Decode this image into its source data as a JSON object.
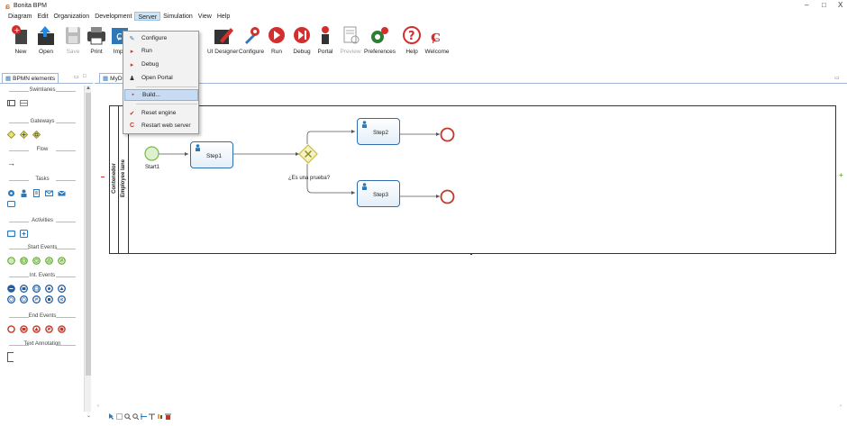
{
  "window": {
    "title": "Bonita BPM",
    "minimize": "–",
    "maximize": "□",
    "close": "X"
  },
  "menu": [
    "Diagram",
    "Edit",
    "Organization",
    "Development",
    "Server",
    "Simulation",
    "View",
    "Help"
  ],
  "toolbar": {
    "items": [
      {
        "label": "New",
        "icon": "new-icon"
      },
      {
        "label": "Open",
        "icon": "open-icon"
      },
      {
        "label": "Save",
        "icon": "save-icon",
        "disabled": true
      },
      {
        "label": "Print",
        "icon": "print-icon"
      },
      {
        "label": "Impo",
        "icon": "import-icon"
      },
      {
        "label": "UI Designer",
        "icon": "ui-designer-icon"
      },
      {
        "label": "Configure",
        "icon": "configure-icon"
      },
      {
        "label": "Run",
        "icon": "run-icon"
      },
      {
        "label": "Debug",
        "icon": "debug-icon"
      },
      {
        "label": "Portal",
        "icon": "portal-icon"
      },
      {
        "label": "Preview",
        "icon": "preview-icon",
        "disabled": true
      },
      {
        "label": "Preferences",
        "icon": "preferences-icon"
      },
      {
        "label": "Help",
        "icon": "help-icon"
      },
      {
        "label": "Welcome",
        "icon": "welcome-icon"
      }
    ]
  },
  "server_menu": {
    "items": [
      {
        "label": "Configure",
        "icon": "configure-icon"
      },
      {
        "label": "Run",
        "icon": "run-icon"
      },
      {
        "label": "Debug",
        "icon": "debug-icon"
      },
      {
        "label": "Open Portal",
        "icon": "portal-icon"
      },
      {
        "label": "Build...",
        "icon": "build-icon",
        "highlighted": true
      },
      {
        "label": "Reset engine",
        "icon": "reset-engine-icon"
      },
      {
        "label": "Restart web server",
        "icon": "restart-server-icon"
      }
    ]
  },
  "palette": {
    "tab": "BPMN elements",
    "sections": {
      "swimlanes": "Swimlanes",
      "gateways": "Gateways",
      "flow": "Flow",
      "tasks": "Tasks",
      "activities": "Activities",
      "start_events": "Start Events",
      "int_events": "Int. Events",
      "end_events": "End Events",
      "text_annotation": "Text Annotation"
    }
  },
  "editor": {
    "tab": "MyDiag",
    "pool": "Contenedor",
    "lane": "Employee lane",
    "start_event": "Start1",
    "tasks": {
      "step1": "Step1",
      "step2": "Step2",
      "step3": "Step3"
    },
    "gateway": "¿Es una prueba?"
  },
  "colors": {
    "task_border": "#2f6fb0",
    "start_event": "#6fbf3a",
    "end_event": "#c0392b",
    "gateway": "#d4c43a",
    "menu_highlight": "#c7dcf3"
  }
}
